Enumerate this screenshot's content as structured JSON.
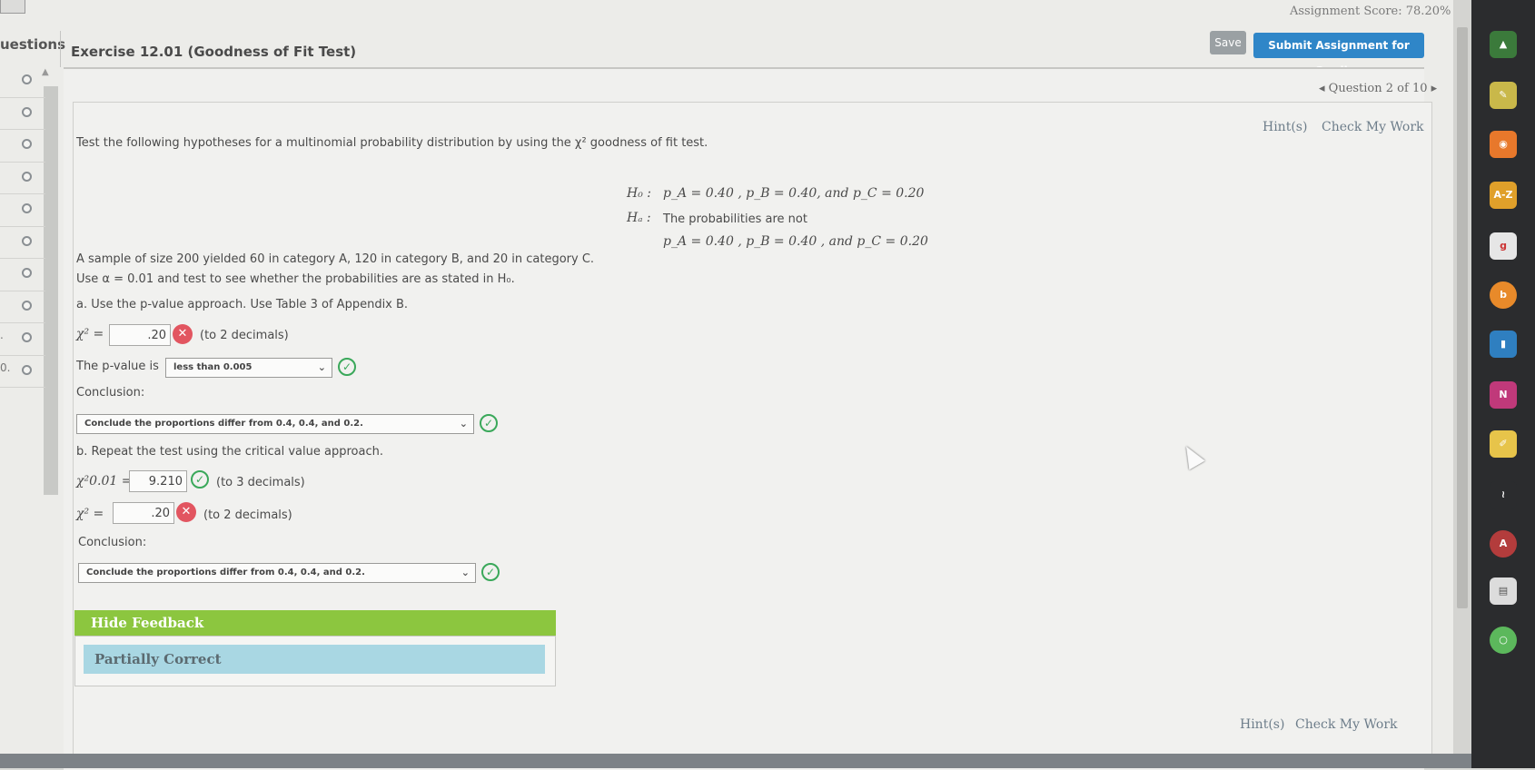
{
  "header": {
    "assignment_score": "Assignment Score: 78.20%",
    "save_label": "Save",
    "submit_label": "Submit Assignment for Grading",
    "questions_tab": "uestions",
    "exercise_title": "Exercise 12.01 (Goodness of Fit Test)",
    "question_nav": "◂ Question 2 of 10 ▸"
  },
  "sidebar": {
    "rows": [
      "",
      "",
      "",
      "",
      "",
      "",
      "",
      "",
      ".",
      "0."
    ]
  },
  "question": {
    "hint_label": "Hint(s)",
    "check_label": "Check My Work",
    "intro": "Test the following hypotheses for a multinomial probability distribution by using the χ² goodness of fit test.",
    "h0_label": "H₀ :",
    "h0_text": "p_A = 0.40 , p_B = 0.40,  and p_C = 0.20",
    "ha_label": "Hₐ :",
    "ha_text1": "The probabilities are not",
    "ha_text2": "p_A = 0.40 , p_B = 0.40 , and p_C = 0.20",
    "sample_text": "A sample of size 200 yielded 60 in category A, 120 in category B, and 20 in category C.",
    "alpha_text": "Use α = 0.01 and test to see whether the probabilities are as stated in H₀.",
    "part_a": "a. Use the p-value approach. Use Table 3 of Appendix B.",
    "chi_label": "χ² =",
    "chi_value": ".20",
    "chi_hint": "(to 2 decimals)",
    "pvalue_label": "The p-value is",
    "pvalue_selected": "less than 0.005",
    "conclusion_label": "Conclusion:",
    "conclusion_a": "Conclude the proportions differ from 0.4, 0.4, and 0.2.",
    "part_b": "b. Repeat the test using the critical value approach.",
    "crit_label": "χ²0.01 =",
    "crit_value": "9.210",
    "crit_hint": "(to 3 decimals)",
    "chi_b_label": "χ² =",
    "chi_b_value": ".20",
    "chi_b_hint": "(to 2 decimals)",
    "conclusion_b_label": "Conclusion:",
    "conclusion_b": "Conclude the proportions differ from 0.4, 0.4, and 0.2."
  },
  "feedback": {
    "hide_label": "Hide Feedback",
    "status": "Partially Correct"
  },
  "dock": {
    "az_label": "A-Z",
    "on_label": "N",
    "at_label": "A"
  }
}
